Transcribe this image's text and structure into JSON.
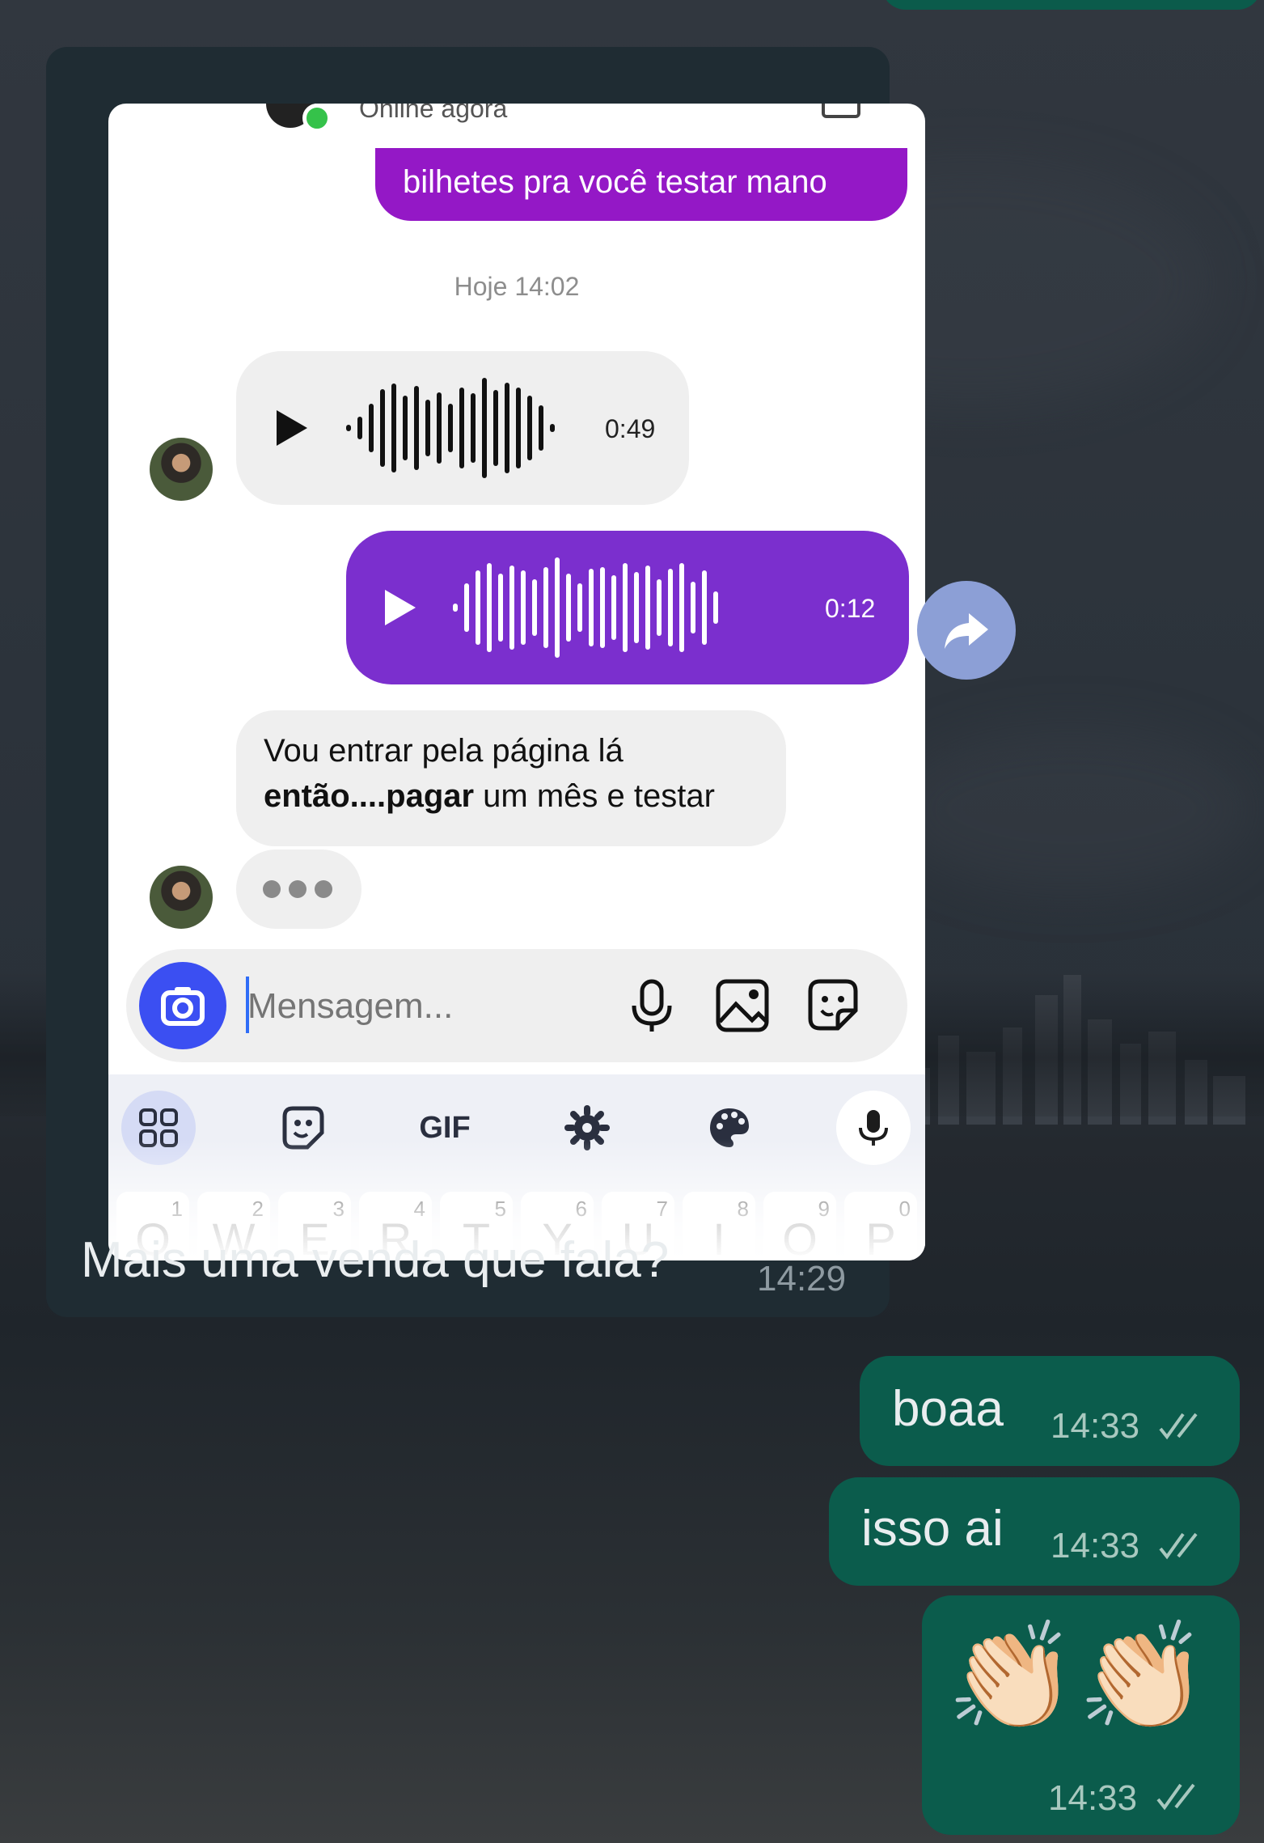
{
  "forwarded": {
    "header_status": "Online agora",
    "outgoing_text": "bilhetes pra você testar mano",
    "date_separator": "Hoje 14:02",
    "incoming_audio_duration": "0:49",
    "outgoing_audio_duration": "0:12",
    "incoming_text_1": "Vou entrar pela página lá",
    "incoming_text_2_bold": "então....pagar",
    "incoming_text_2_rest": " um mês e testar",
    "composer_placeholder": "Mensagem...",
    "keyboard": {
      "gif_label": "GIF",
      "keys": [
        {
          "l": "Q",
          "n": "1"
        },
        {
          "l": "W",
          "n": "2"
        },
        {
          "l": "E",
          "n": "3"
        },
        {
          "l": "R",
          "n": "4"
        },
        {
          "l": "T",
          "n": "5"
        },
        {
          "l": "Y",
          "n": "6"
        },
        {
          "l": "U",
          "n": "7"
        },
        {
          "l": "I",
          "n": "8"
        },
        {
          "l": "O",
          "n": "9"
        },
        {
          "l": "P",
          "n": "0"
        }
      ]
    }
  },
  "received_caption": "Mais uma venda que fala?",
  "received_time": "14:29",
  "sent_messages": [
    {
      "text": "boaa",
      "time": "14:33"
    },
    {
      "text": "isso ai",
      "time": "14:33"
    },
    {
      "text": "👏🏻👏🏻",
      "time": "14:33"
    }
  ],
  "colors": {
    "sent_bubble": "#0b5c4c",
    "instagram_purple": "#7b2fce",
    "instagram_magenta": "#9418c6",
    "camera_blue": "#3b4ff2",
    "forward_button": "#8c9fd6"
  }
}
